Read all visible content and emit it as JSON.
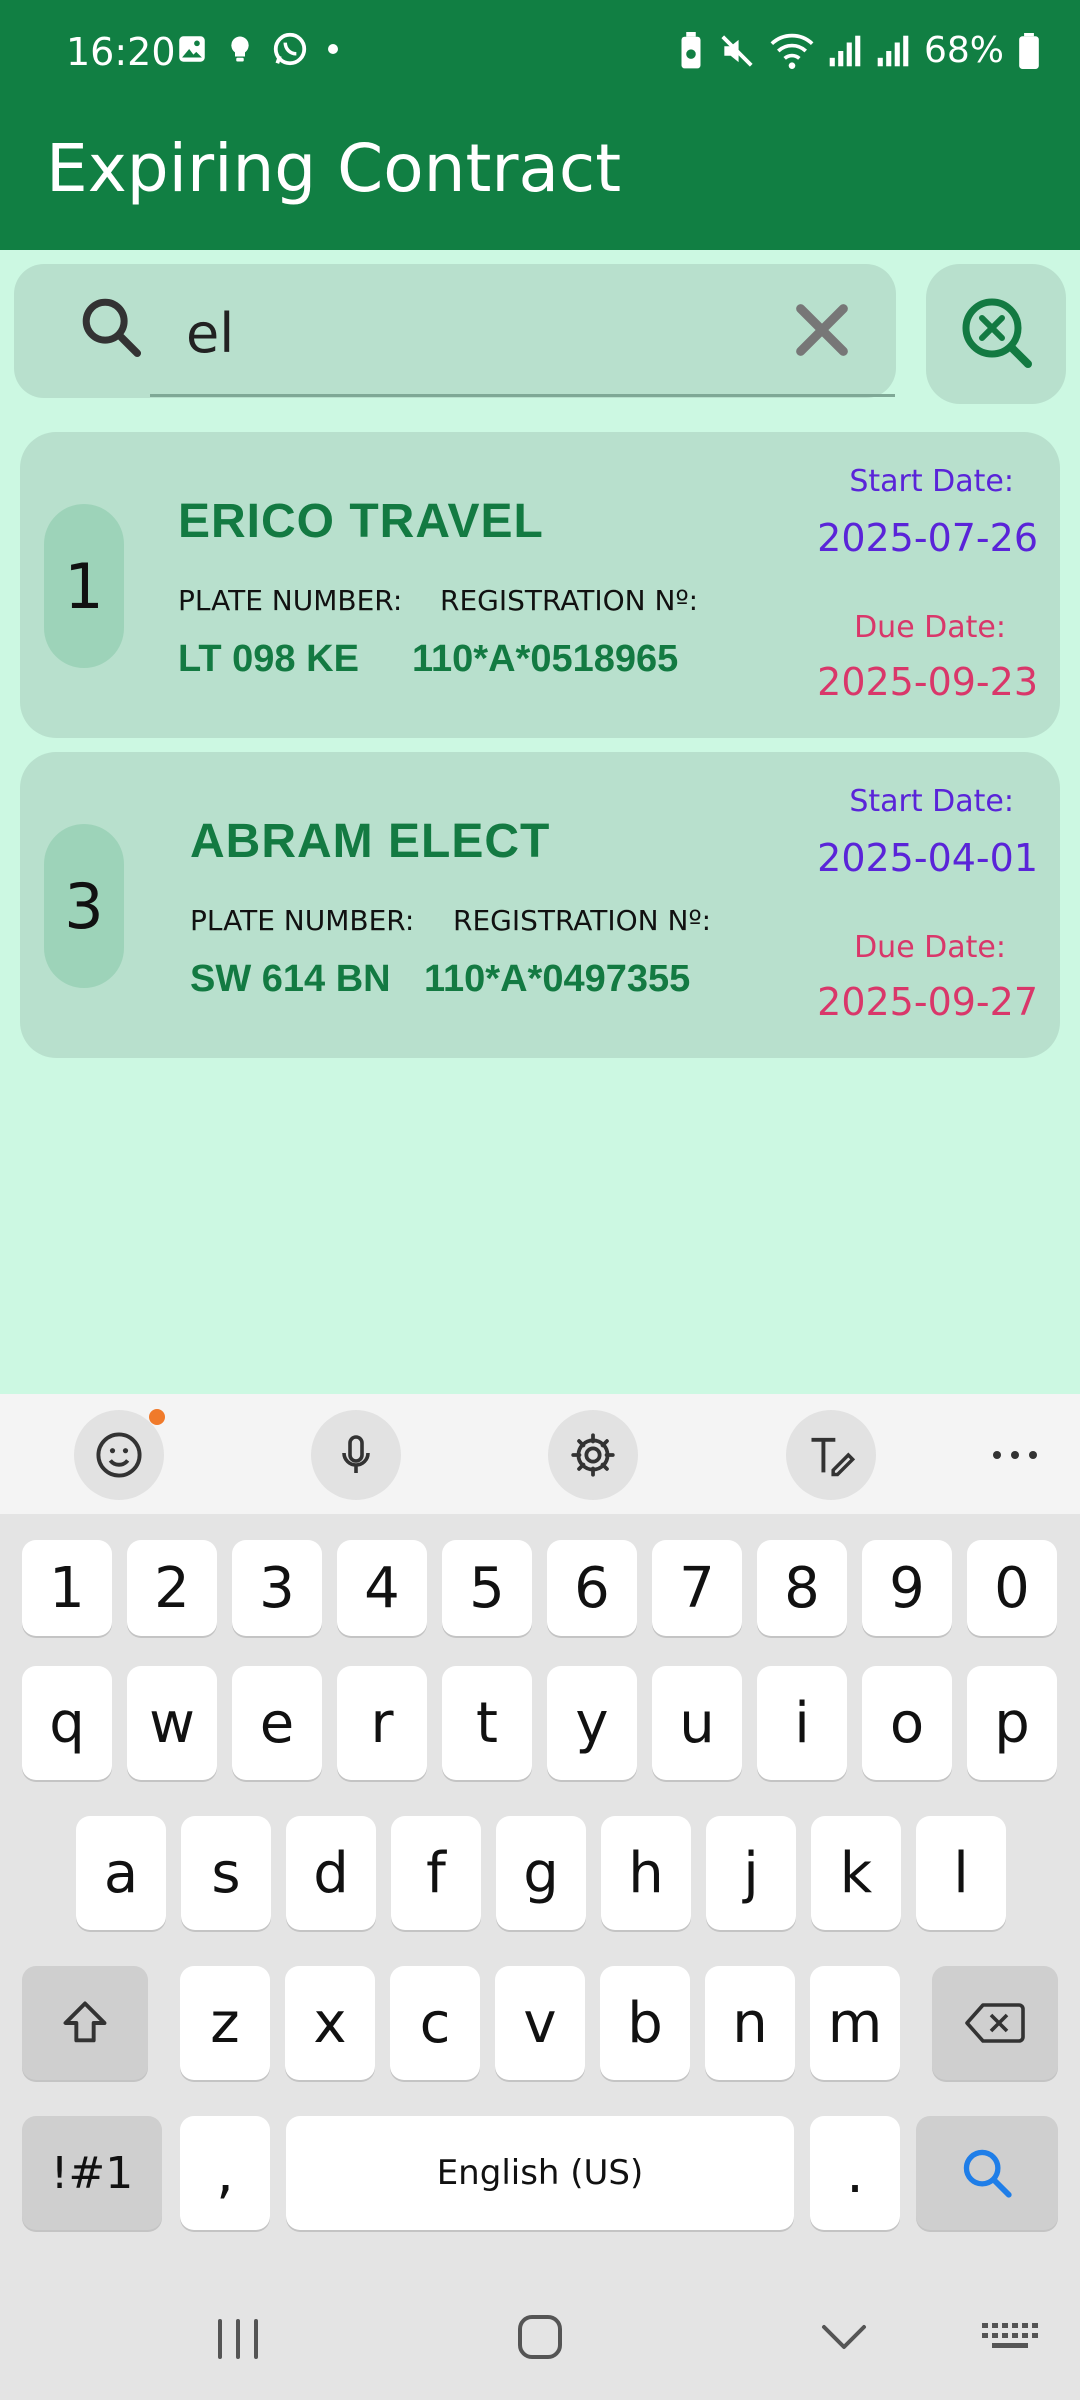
{
  "status_bar": {
    "time": "16:20",
    "battery": "68%",
    "left_icons": [
      "gallery-icon",
      "bulb-icon",
      "whatsapp-icon",
      "dot-icon"
    ],
    "right_icons": [
      "battery-saver-icon",
      "mute-icon",
      "wifi-icon",
      "signal-icon",
      "signal-icon",
      "battery-icon"
    ]
  },
  "header": {
    "title": "Expiring Contract"
  },
  "search": {
    "value": "el",
    "placeholder": ""
  },
  "contracts": [
    {
      "number": "1",
      "name": "ERICO TRAVEL",
      "plate_label": "PLATE NUMBER:",
      "plate": "LT 098 KE",
      "reg_label": "REGISTRATION Nº:",
      "reg": "110*A*0518965",
      "start_label": "Start Date:",
      "start_date": "2025-07-26",
      "due_label": "Due Date:",
      "due_date": "2025-09-23"
    },
    {
      "number": "3",
      "name": "ABRAM ELECT",
      "plate_label": "PLATE NUMBER:",
      "plate": "SW 614 BN",
      "reg_label": "REGISTRATION Nº:",
      "reg": "110*A*0497355",
      "start_label": "Start Date:",
      "start_date": "2025-04-01",
      "due_label": "Due Date:",
      "due_date": "2025-09-27"
    }
  ],
  "keyboard": {
    "numbers": [
      "1",
      "2",
      "3",
      "4",
      "5",
      "6",
      "7",
      "8",
      "9",
      "0"
    ],
    "row1": [
      "q",
      "w",
      "e",
      "r",
      "t",
      "y",
      "u",
      "i",
      "o",
      "p"
    ],
    "row2": [
      "a",
      "s",
      "d",
      "f",
      "g",
      "h",
      "j",
      "k",
      "l"
    ],
    "row3": [
      "z",
      "x",
      "c",
      "v",
      "b",
      "n",
      "m"
    ],
    "symbols_key": "!#1",
    "comma": ",",
    "space": "English (US)",
    "period": "."
  },
  "colors": {
    "app_bar": "#117f43",
    "background": "#ccf8e2",
    "card": "#b8e0cd",
    "accent_green": "#137a42",
    "start_purple": "#5a24d8",
    "due_pink": "#d9376a"
  }
}
